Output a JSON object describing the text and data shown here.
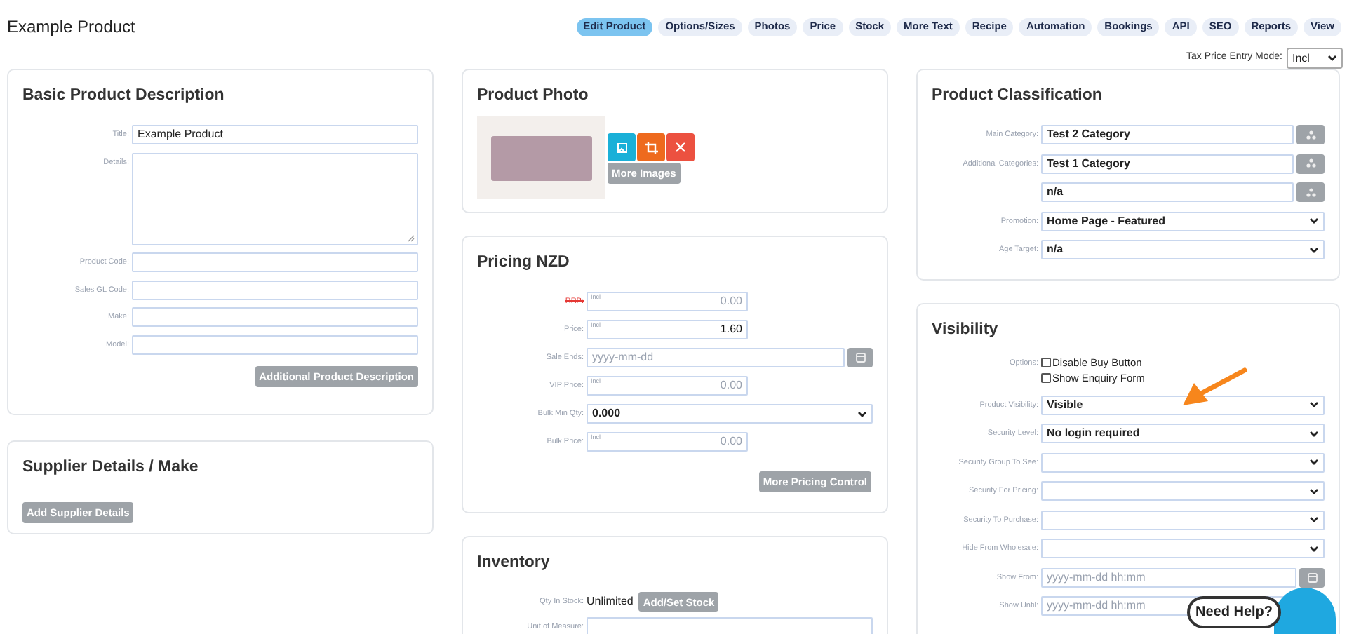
{
  "header": {
    "title": "Example Product"
  },
  "tabs": [
    {
      "label": "Edit Product",
      "selected": true
    },
    {
      "label": "Options/Sizes",
      "selected": false
    },
    {
      "label": "Photos",
      "selected": false
    },
    {
      "label": "Price",
      "selected": false
    },
    {
      "label": "Stock",
      "selected": false
    },
    {
      "label": "More Text",
      "selected": false
    },
    {
      "label": "Recipe",
      "selected": false
    },
    {
      "label": "Automation",
      "selected": false
    },
    {
      "label": "Bookings",
      "selected": false
    },
    {
      "label": "API",
      "selected": false
    },
    {
      "label": "SEO",
      "selected": false
    },
    {
      "label": "Reports",
      "selected": false
    },
    {
      "label": "View",
      "selected": false
    }
  ],
  "tax_mode": {
    "label": "Tax Price Entry Mode:",
    "value": "Incl"
  },
  "basic_description": {
    "title": "Basic Product Description",
    "fields": [
      {
        "kind": "text",
        "label": "Title:",
        "value": "Example Product"
      },
      {
        "kind": "textarea",
        "label": "Details:"
      },
      {
        "kind": "text",
        "label": "Product Code:"
      },
      {
        "kind": "text",
        "label": "Sales GL Code:"
      },
      {
        "kind": "text",
        "label": "Make:"
      },
      {
        "kind": "text",
        "label": "Model:"
      }
    ],
    "button": "Additional Product Description"
  },
  "supplier": {
    "title": "Supplier Details / Make",
    "button": "Add Supplier Details"
  },
  "photo": {
    "title": "Product Photo",
    "more_button": "More Images"
  },
  "pricing": {
    "title": "Pricing NZD",
    "fields": [
      {
        "kind": "price",
        "label": "RRP:",
        "struck": true,
        "prefix": "Incl",
        "placeholder": "0.00"
      },
      {
        "kind": "price",
        "label": "Price:",
        "struck": false,
        "prefix": "Incl",
        "value": "1.60"
      },
      {
        "kind": "date",
        "label": "Sale Ends:",
        "placeholder": "yyyy-mm-dd"
      },
      {
        "kind": "price",
        "label": "VIP Price:",
        "struck": false,
        "prefix": "Incl",
        "placeholder": "0.00"
      },
      {
        "kind": "select",
        "label": "Bulk Min Qty:",
        "value": "0.000"
      },
      {
        "kind": "price",
        "label": "Bulk Price:",
        "struck": false,
        "prefix": "Incl",
        "placeholder": "0.00"
      }
    ],
    "button": "More Pricing Control"
  },
  "inventory": {
    "title": "Inventory",
    "fields": [
      {
        "kind": "stock",
        "label": "Qty In Stock:",
        "value": "Unlimited",
        "button": "Add/Set Stock"
      },
      {
        "kind": "text",
        "label": "Unit of Measure:"
      }
    ]
  },
  "classification": {
    "title": "Product Classification",
    "fields": [
      {
        "kind": "category",
        "label": "Main Category:",
        "value": "Test 2 Category"
      },
      {
        "kind": "category",
        "label": "Additional Categories:",
        "value": "Test 1 Category"
      },
      {
        "kind": "category",
        "value": "n/a"
      },
      {
        "kind": "select",
        "label": "Promotion:",
        "value": "Home Page - Featured"
      },
      {
        "kind": "select",
        "label": "Age Target:",
        "value": "n/a"
      }
    ]
  },
  "visibility": {
    "title": "Visibility",
    "fields": [
      {
        "kind": "checks",
        "label": "Options:",
        "options": [
          {
            "label": "Disable Buy Button",
            "checked": false
          },
          {
            "label": "Show Enquiry Form",
            "checked": false
          }
        ]
      },
      {
        "kind": "select",
        "label": "Product Visibility:",
        "value": "Visible"
      },
      {
        "kind": "select",
        "label": "Security Level:",
        "value": "No login required"
      },
      {
        "kind": "select",
        "label": "Security Group To See:"
      },
      {
        "kind": "select",
        "label": "Security For Pricing:"
      },
      {
        "kind": "select",
        "label": "Security To Purchase:"
      },
      {
        "kind": "select",
        "label": "Hide From Wholesale:"
      },
      {
        "kind": "date",
        "label": "Show From:",
        "placeholder": "yyyy-mm-dd hh:mm"
      },
      {
        "kind": "date",
        "label": "Show Until:",
        "placeholder": "yyyy-mm-dd hh:mm"
      }
    ]
  },
  "help": {
    "label": "Need Help?"
  }
}
